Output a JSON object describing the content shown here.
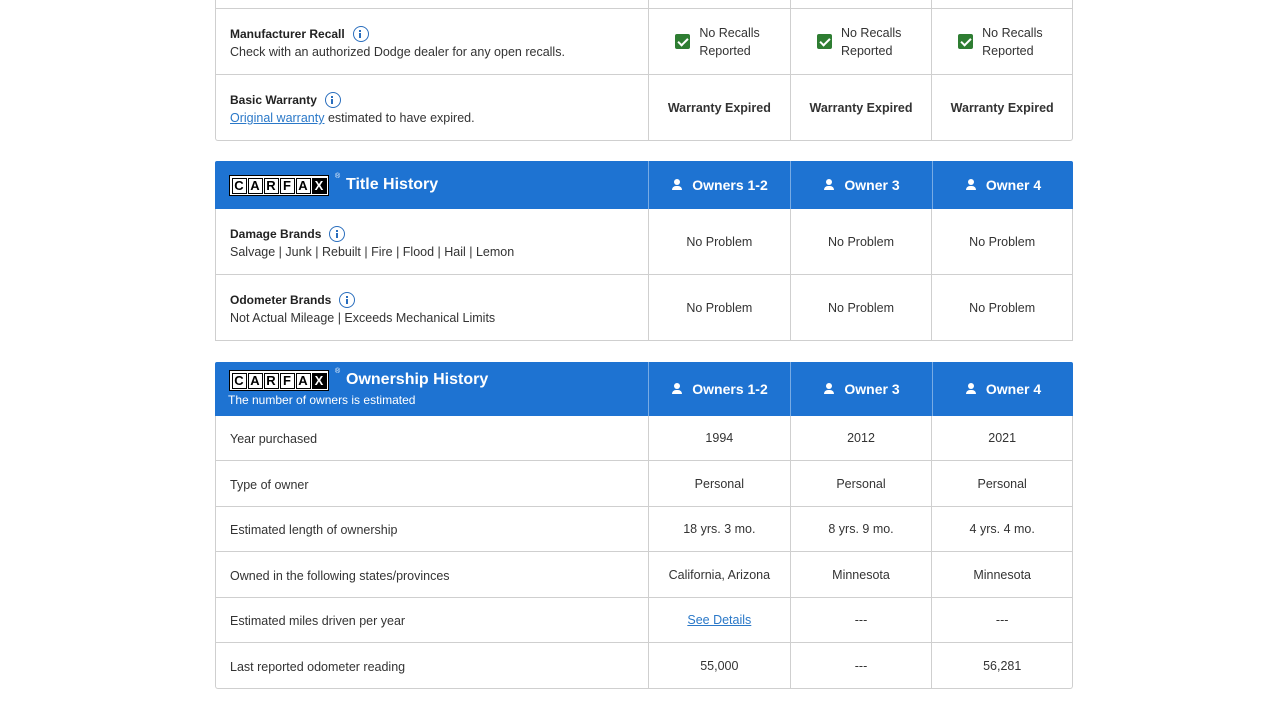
{
  "warranty_section": {
    "recall": {
      "title": "Manufacturer Recall",
      "subtitle": "Check with an authorized Dodge dealer for any open recalls.",
      "cells": [
        "No Recalls Reported",
        "No Recalls Reported",
        "No Recalls Reported"
      ]
    },
    "warranty": {
      "title": "Basic Warranty",
      "link_text": "Original warranty",
      "subtitle_rest": " estimated to have expired.",
      "cells": [
        "Warranty Expired",
        "Warranty Expired",
        "Warranty Expired"
      ]
    }
  },
  "logo": {
    "letters": [
      "C",
      "A",
      "R",
      "F",
      "A",
      "X"
    ],
    "reg": "®"
  },
  "owner_columns": [
    "Owners 1-2",
    "Owner 3",
    "Owner 4"
  ],
  "title_history": {
    "heading": "Title History",
    "rows": [
      {
        "title": "Damage Brands",
        "subtitle": "Salvage | Junk | Rebuilt | Fire | Flood | Hail | Lemon",
        "cells": [
          "No Problem",
          "No Problem",
          "No Problem"
        ]
      },
      {
        "title": "Odometer Brands",
        "subtitle": "Not Actual Mileage | Exceeds Mechanical Limits",
        "cells": [
          "No Problem",
          "No Problem",
          "No Problem"
        ]
      }
    ]
  },
  "ownership_history": {
    "heading": "Ownership History",
    "subheading": "The number of owners is estimated",
    "rows": [
      {
        "label": "Year purchased",
        "cells": [
          "1994",
          "2012",
          "2021"
        ]
      },
      {
        "label": "Type of owner",
        "cells": [
          "Personal",
          "Personal",
          "Personal"
        ]
      },
      {
        "label": "Estimated length of ownership",
        "cells": [
          "18 yrs. 3 mo.",
          "8 yrs. 9 mo.",
          "4 yrs. 4 mo."
        ]
      },
      {
        "label": "Owned in the following states/provinces",
        "cells": [
          "California, Arizona",
          "Minnesota",
          "Minnesota"
        ]
      },
      {
        "label": "Estimated miles driven per year",
        "cells": [
          "See Details",
          "---",
          "---"
        ]
      },
      {
        "label": "Last reported odometer reading",
        "cells": [
          "55,000",
          "---",
          "56,281"
        ]
      }
    ]
  },
  "colors": {
    "header_blue": "#1e73d2",
    "check_green": "#2e7d32",
    "link_blue": "#2a78c8"
  }
}
